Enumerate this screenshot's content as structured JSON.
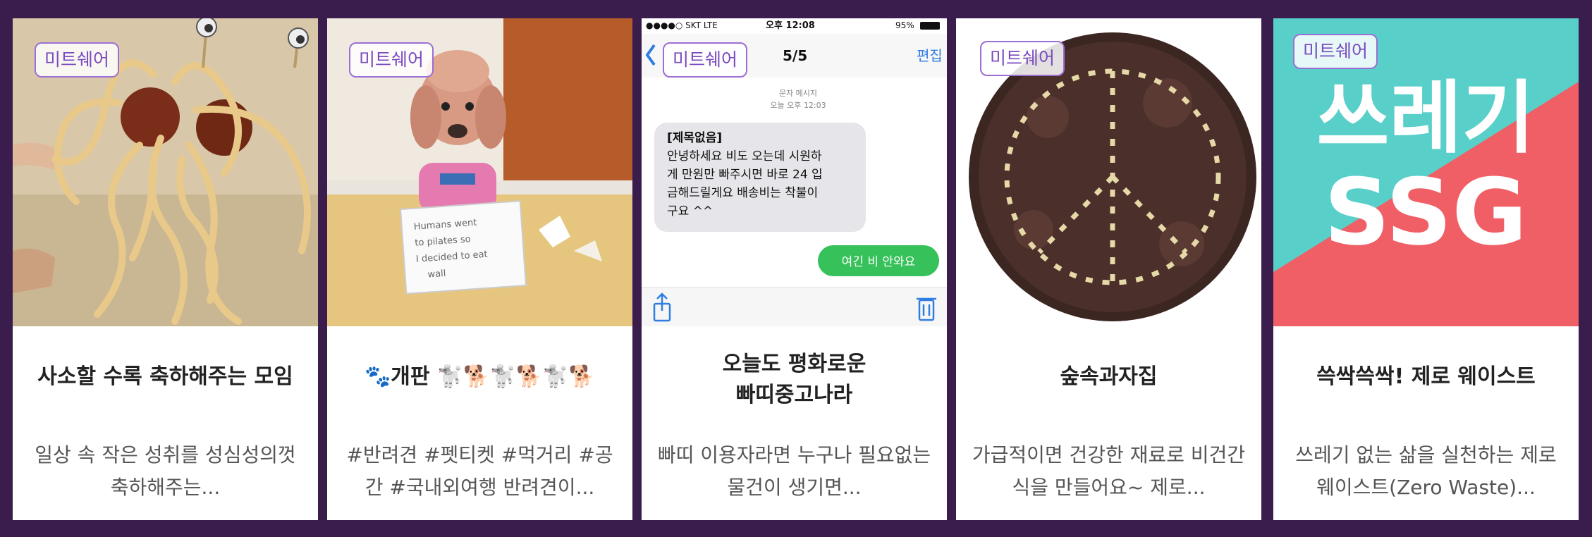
{
  "badge_label": "미트쉐어",
  "cards": [
    {
      "title": "사소할 수록 축하해주는 모임",
      "desc": "일상 속 작은 성취를 성심성의껏 축하해주는..."
    },
    {
      "title": "🐾개판 🐩🐕🐩🐕🐩🐕",
      "desc": "#반려견 #펫티켓 #먹거리 #공간 #국내외여행 반려견이..."
    },
    {
      "title_lines": [
        "오늘도 평화로운",
        "빠띠중고나라"
      ],
      "desc": "빠띠 이용자라면 누구나 필요없는 물건이 생기면..."
    },
    {
      "title": "숲속과자집",
      "desc": "가급적이면 건강한 재료로 비건간식을 만들어요~ 제로..."
    },
    {
      "title": "쓱싹쓱싹! 제로 웨이스트",
      "desc": "쓰레기 없는 삶을 실천하는 제로 웨이스트(Zero Waste)..."
    }
  ],
  "phone": {
    "status_left": "●●●●○ SKT  LTE",
    "status_time": "오후 12:08",
    "status_battery": "95%",
    "nav_title": "5/5",
    "nav_edit": "편집",
    "meta_line1": "문자 메시지",
    "meta_line2": "오늘 오후 12:03",
    "bubble_in_lines": [
      "[제목없음]",
      "안녕하세요 비도 오는데 시원하",
      "게 만원만 빠주시면 바로 24 입",
      "금해드릴게요 배송비는 착불이",
      "구요 ^^"
    ],
    "bubble_out": "여긴 비 안와요"
  },
  "sign_lines": [
    "Humans went",
    "to pilates so",
    "I decided to eat",
    "wall"
  ],
  "poster": {
    "line1": "쓰레기",
    "line2": "SSG"
  }
}
